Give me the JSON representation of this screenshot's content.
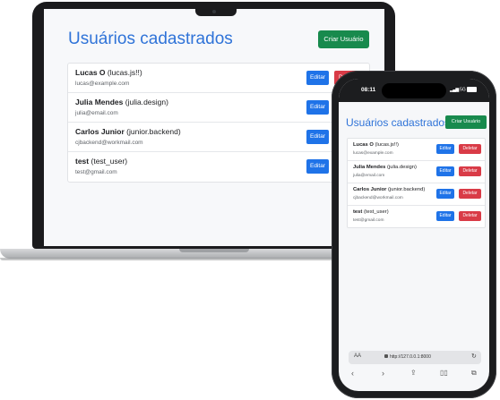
{
  "laptop": {
    "title": "Usuários cadastrados",
    "create_button": "Criar Usuário",
    "users": [
      {
        "name": "Lucas O",
        "username": "(lucas.js!!)",
        "email": "lucas@example.com",
        "edit": "Editar",
        "delete": "Deletar"
      },
      {
        "name": "Julia Mendes",
        "username": "(julia.design)",
        "email": "julia@email.com",
        "edit": "Editar",
        "delete": "Deletar"
      },
      {
        "name": "Carlos Junior",
        "username": "(junior.backend)",
        "email": "cjbackend@workmail.com",
        "edit": "Editar",
        "delete": "Deletar"
      },
      {
        "name": "test",
        "username": "(test_user)",
        "email": "test@gmail.com",
        "edit": "Editar",
        "delete": "Deletar"
      }
    ]
  },
  "phone": {
    "status_time": "08:11",
    "status_signal": "5G",
    "title": "Usuários cadastrados",
    "create_button": "Criar Usuário",
    "users": [
      {
        "name": "Lucas O",
        "username": "(lucas.js!!)",
        "email": "lucas@example.com",
        "edit": "Editar",
        "delete": "Deletar"
      },
      {
        "name": "Julia Mendes",
        "username": "(julia.design)",
        "email": "julia@email.com",
        "edit": "Editar",
        "delete": "Deletar"
      },
      {
        "name": "Carlos Junior",
        "username": "(junior.backend)",
        "email": "cjbackend@workmail.com",
        "edit": "Editar",
        "delete": "Deletar"
      },
      {
        "name": "test",
        "username": "(test_user)",
        "email": "test@gmail.com",
        "edit": "Editar",
        "delete": "Deletar"
      }
    ],
    "url_aa": "AA",
    "url": "http://127.0.0.1:8000",
    "nav_icons": [
      "back-icon",
      "forward-icon",
      "share-icon",
      "bookmarks-icon",
      "tabs-icon"
    ]
  },
  "colors": {
    "title": "#2f73d8",
    "create": "#188a4d",
    "edit": "#1f73e8",
    "delete": "#d93b47"
  }
}
